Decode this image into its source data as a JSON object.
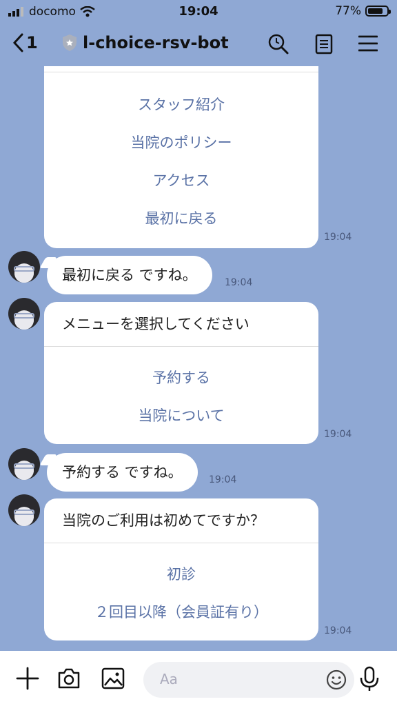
{
  "status": {
    "carrier": "docomo",
    "time": "19:04",
    "battery": "77%"
  },
  "header": {
    "back_count": "1",
    "title": "l-choice-rsv-bot"
  },
  "messages": {
    "card1": {
      "options": [
        "スタッフ紹介",
        "当院のポリシー",
        "アクセス",
        "最初に戻る"
      ],
      "time": "19:04"
    },
    "reply1": {
      "text": "最初に戻る ですね。",
      "time": "19:04"
    },
    "card2": {
      "title": "メニューを選択してください",
      "options": [
        "予約する",
        "当院について"
      ],
      "time": "19:04"
    },
    "reply2": {
      "text": "予約する ですね。",
      "time": "19:04"
    },
    "card3": {
      "title": "当院のご利用は初めてですか？",
      "options": [
        "初診",
        "２回目以降（会員証有り）"
      ],
      "time": "19:04"
    }
  },
  "input": {
    "placeholder": "Aa"
  },
  "icons": [
    "signal-icon",
    "wifi-icon",
    "battery-icon",
    "back-chevron-icon",
    "shield-icon",
    "search-icon",
    "notes-icon",
    "menu-icon",
    "plus-icon",
    "camera-icon",
    "image-icon",
    "emoji-icon",
    "mic-icon"
  ]
}
